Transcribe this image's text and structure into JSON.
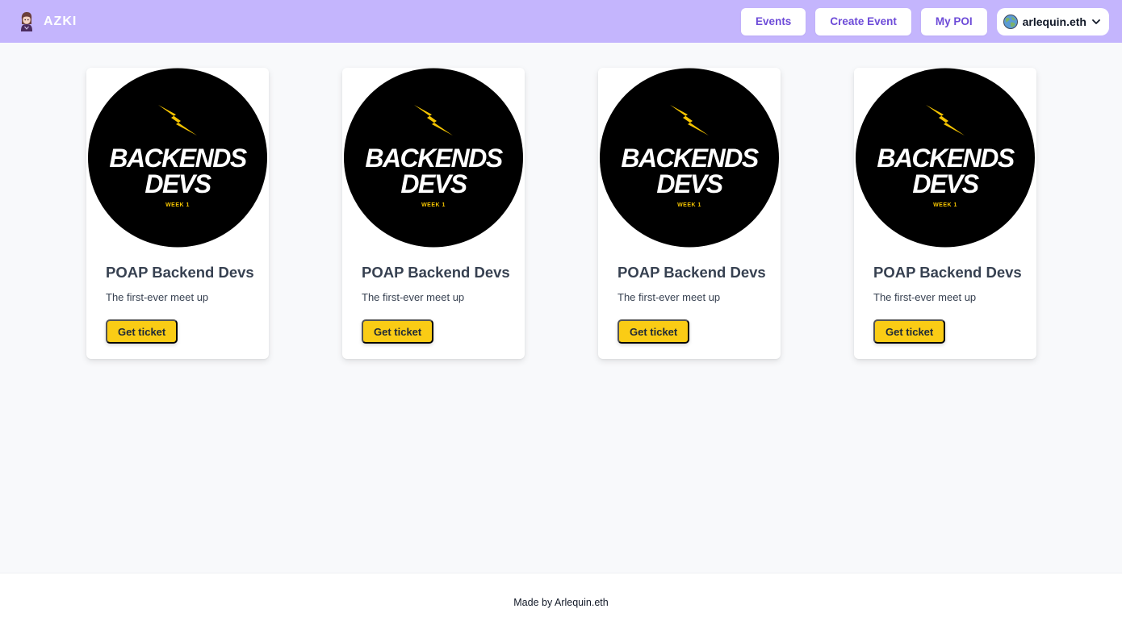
{
  "header": {
    "brand": "AZKI",
    "nav": {
      "events": "Events",
      "create_event": "Create Event",
      "my_poi": "My POI"
    },
    "account": {
      "name": "arlequin.eth"
    }
  },
  "events": [
    {
      "image": {
        "headline_1": "BACKENDS",
        "headline_2": "DEVS",
        "sub": "WEEK 1"
      },
      "title": "POAP Backend Devs",
      "description": "The first-ever meet up",
      "button": "Get ticket"
    },
    {
      "image": {
        "headline_1": "BACKENDS",
        "headline_2": "DEVS",
        "sub": "WEEK 1"
      },
      "title": "POAP Backend Devs",
      "description": "The first-ever meet up",
      "button": "Get ticket"
    },
    {
      "image": {
        "headline_1": "BACKENDS",
        "headline_2": "DEVS",
        "sub": "WEEK 1"
      },
      "title": "POAP Backend Devs",
      "description": "The first-ever meet up",
      "button": "Get ticket"
    },
    {
      "image": {
        "headline_1": "BACKENDS",
        "headline_2": "DEVS",
        "sub": "WEEK 1"
      },
      "title": "POAP Backend Devs",
      "description": "The first-ever meet up",
      "button": "Get ticket"
    }
  ],
  "footer": {
    "text": "Made by Arlequin.eth"
  },
  "colors": {
    "navbar": "#c4b5fd",
    "nav_text": "#6d4bd8",
    "ticket_button": "#facc15",
    "page_background": "#f8f9fb"
  },
  "icons": {
    "brand": "avatar-icon",
    "account": "globe-icon",
    "account_menu": "chevron-down-icon",
    "event_image_mark": "lightning-bolt-icon"
  }
}
